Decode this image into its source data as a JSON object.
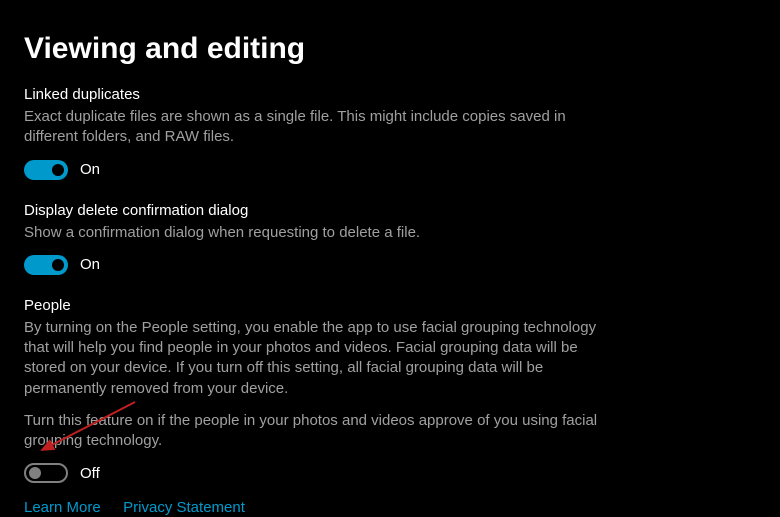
{
  "page": {
    "title": "Viewing and editing"
  },
  "linked_duplicates": {
    "title": "Linked duplicates",
    "desc": "Exact duplicate files are shown as a single file. This might include copies saved in different folders, and RAW files.",
    "state": "On"
  },
  "delete_confirmation": {
    "title": "Display delete confirmation dialog",
    "desc": "Show a confirmation dialog when requesting to delete a file.",
    "state": "On"
  },
  "people": {
    "title": "People",
    "desc": "By turning on the People setting, you enable the app to use facial grouping technology that will help you find people in your photos and videos. Facial grouping data will be stored on your device. If you turn off this setting, all facial grouping data will be permanently removed from your device.",
    "desc2": "Turn this feature on if the people in your photos and videos approve of you using facial grouping technology.",
    "state": "Off"
  },
  "links": {
    "learn_more": "Learn More",
    "privacy": "Privacy Statement"
  }
}
